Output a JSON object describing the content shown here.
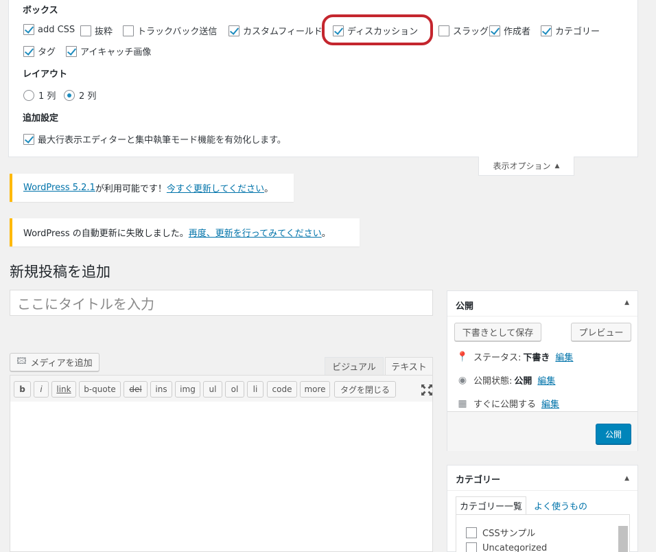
{
  "screen_options": {
    "boxes_heading": "ボックス",
    "boxes": [
      {
        "label": "add CSS",
        "checked": true
      },
      {
        "label": "抜粋",
        "checked": false
      },
      {
        "label": "トラックバック送信",
        "checked": false
      },
      {
        "label": "カスタムフィールド",
        "checked": true
      },
      {
        "label": "ディスカッション",
        "checked": true
      },
      {
        "label": "スラッグ",
        "checked": false
      },
      {
        "label": "作成者",
        "checked": true
      },
      {
        "label": "カテゴリー",
        "checked": true
      },
      {
        "label": "タグ",
        "checked": true
      },
      {
        "label": "アイキャッチ画像",
        "checked": true
      }
    ],
    "layout_heading": "レイアウト",
    "layout_options": [
      {
        "label": "1 列",
        "selected": false
      },
      {
        "label": "2 列",
        "selected": true
      }
    ],
    "additional_heading": "追加設定",
    "additional_option": {
      "label": "最大行表示エディターと集中執筆モード機能を有効化します。",
      "checked": true
    },
    "tab_label": "表示オプション",
    "highlight_color": "#c4262e"
  },
  "notices": {
    "update_available": {
      "link1": "WordPress 5.2.1",
      "text": " が利用可能です！",
      "link2": "今すぐ更新してください",
      "suffix": "。"
    },
    "auto_update_failed": {
      "text": "WordPress の自動更新に失敗しました。",
      "link": "再度、更新を行ってみてください",
      "suffix": "。"
    }
  },
  "page": {
    "title": "新規投稿を追加",
    "title_placeholder": "ここにタイトルを入力"
  },
  "editor": {
    "add_media": "メディアを追加",
    "tab_visual": "ビジュアル",
    "tab_text": "テキスト",
    "quicktags": [
      "b",
      "i",
      "link",
      "b-quote",
      "del",
      "ins",
      "img",
      "ul",
      "ol",
      "li",
      "code",
      "more",
      "タグを閉じる"
    ]
  },
  "publish": {
    "title": "公開",
    "save_draft": "下書きとして保存",
    "preview": "プレビュー",
    "status_label": "ステータス:",
    "status_value": "下書き",
    "visibility_label": "公開状態:",
    "visibility_value": "公開",
    "schedule_label": "すぐに公開する",
    "edit": "編集",
    "publish_button": "公開",
    "accent": "#0085ba"
  },
  "categories": {
    "title": "カテゴリー",
    "tab_all": "カテゴリー一覧",
    "tab_popular": "よく使うもの",
    "items": [
      "CSSサンプル",
      "Uncategorized"
    ]
  }
}
